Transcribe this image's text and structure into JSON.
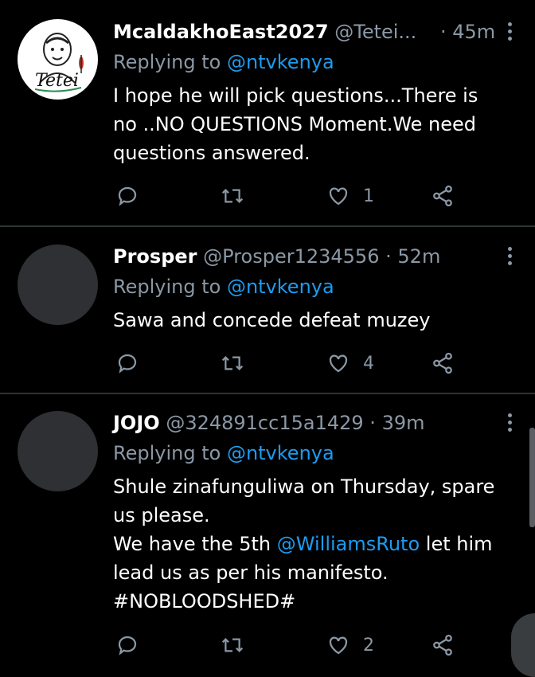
{
  "tweets": [
    {
      "name": "McaldakhoEast2027",
      "handle": "@Tetei...",
      "separator": "·",
      "time": "45m",
      "replying_prefix": "Replying to ",
      "replying_handle": "@ntvkenya",
      "lines": [
        "I hope he will pick questions...There is",
        "no ..NO QUESTIONS Moment.We need",
        "questions answered."
      ],
      "likes": "1",
      "avatar_logo_text": "Tetei"
    },
    {
      "name": "Prosper",
      "handle": "@Prosper1234556",
      "separator": "·",
      "time": "52m",
      "replying_prefix": "Replying to ",
      "replying_handle": "@ntvkenya",
      "lines": [
        "Sawa and concede defeat muzey"
      ],
      "likes": "4"
    },
    {
      "name": "JOJO",
      "handle": "@324891cc15a1429",
      "separator": "·",
      "time": "39m",
      "replying_prefix": "Replying to ",
      "replying_handle": "@ntvkenya",
      "line1": "Shule zinafunguliwa on Thursday, spare",
      "line2": "us please.",
      "line3_prefix": "We have the 5th ",
      "line3_mention": "@WilliamsRuto",
      "line3_suffix": " let him",
      "line4": "lead us as per his manifesto.",
      "line5": "#NOBLOODSHED#",
      "likes": "2"
    }
  ],
  "colors": {
    "background": "#000000",
    "link": "#1d9bf0",
    "muted": "#8b98a5",
    "divider": "#2f3336"
  },
  "icons": [
    "reply-icon",
    "retweet-icon",
    "like-icon",
    "share-icon",
    "more-icon"
  ]
}
